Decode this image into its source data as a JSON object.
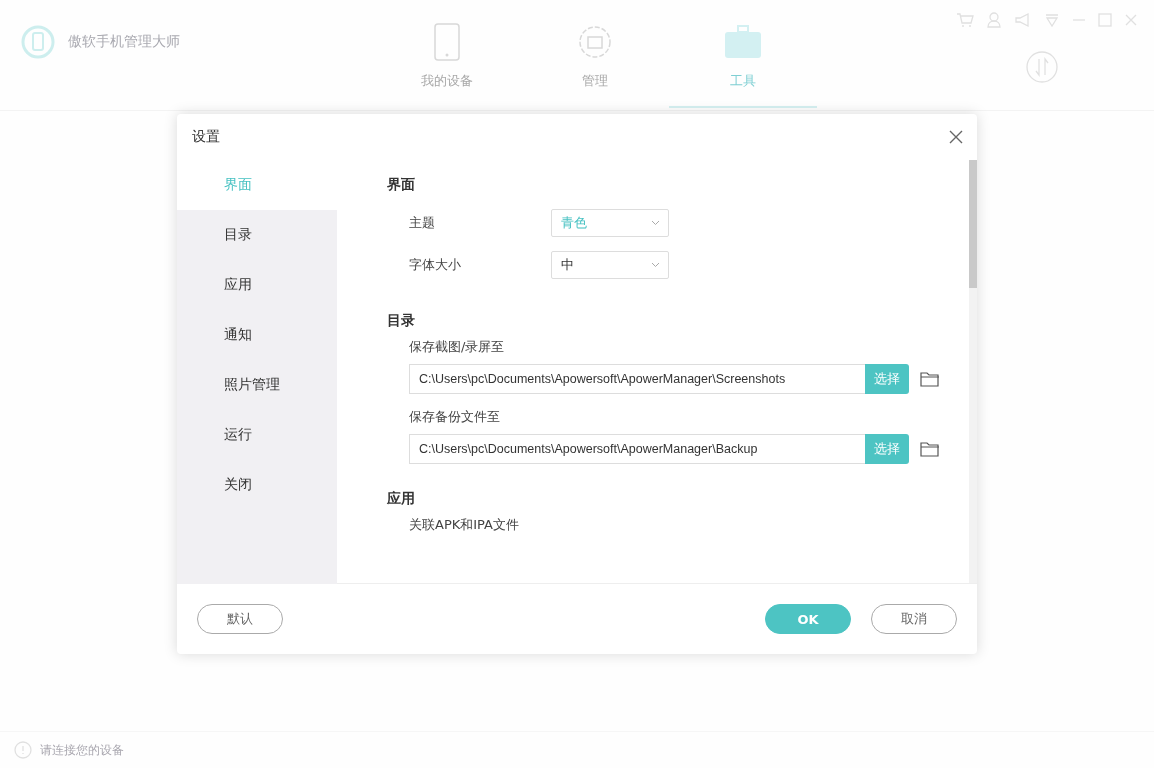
{
  "app": {
    "title": "傲软手机管理大师",
    "tabs": [
      {
        "label": "我的设备",
        "kind": "phone",
        "selected": false
      },
      {
        "label": "管理",
        "kind": "gear",
        "selected": false
      },
      {
        "label": "工具",
        "kind": "toolbox",
        "selected": true
      }
    ],
    "status_text": "请连接您的设备"
  },
  "dialog": {
    "title": "设置",
    "nav": [
      {
        "label": "界面",
        "selected": true
      },
      {
        "label": "目录",
        "selected": false
      },
      {
        "label": "应用",
        "selected": false
      },
      {
        "label": "通知",
        "selected": false
      },
      {
        "label": "照片管理",
        "selected": false
      },
      {
        "label": "运行",
        "selected": false
      },
      {
        "label": "关闭",
        "selected": false
      }
    ],
    "sections": [
      {
        "title": "界面",
        "rows": [
          {
            "kind": "select",
            "label": "主题",
            "value": "青色",
            "highlighted": true
          },
          {
            "kind": "select",
            "label": "字体大小",
            "value": "中",
            "highlighted": false
          }
        ]
      },
      {
        "title": "目录",
        "rows": [
          {
            "kind": "path",
            "label": "保存截图/录屏至",
            "value": "C:\\Users\\pc\\Documents\\Apowersoft\\ApowerManager\\Screenshots",
            "button": "选择"
          },
          {
            "kind": "path",
            "label": "保存备份文件至",
            "value": "C:\\Users\\pc\\Documents\\Apowersoft\\ApowerManager\\Backup",
            "button": "选择"
          }
        ]
      },
      {
        "title": "应用",
        "rows": [
          {
            "kind": "text",
            "label": "关联APK和IPA文件"
          }
        ]
      }
    ],
    "buttons": [
      {
        "label": "默认",
        "kind": "secondary"
      },
      {
        "label": "OK",
        "kind": "primary"
      },
      {
        "label": "取消",
        "kind": "secondary"
      }
    ]
  }
}
